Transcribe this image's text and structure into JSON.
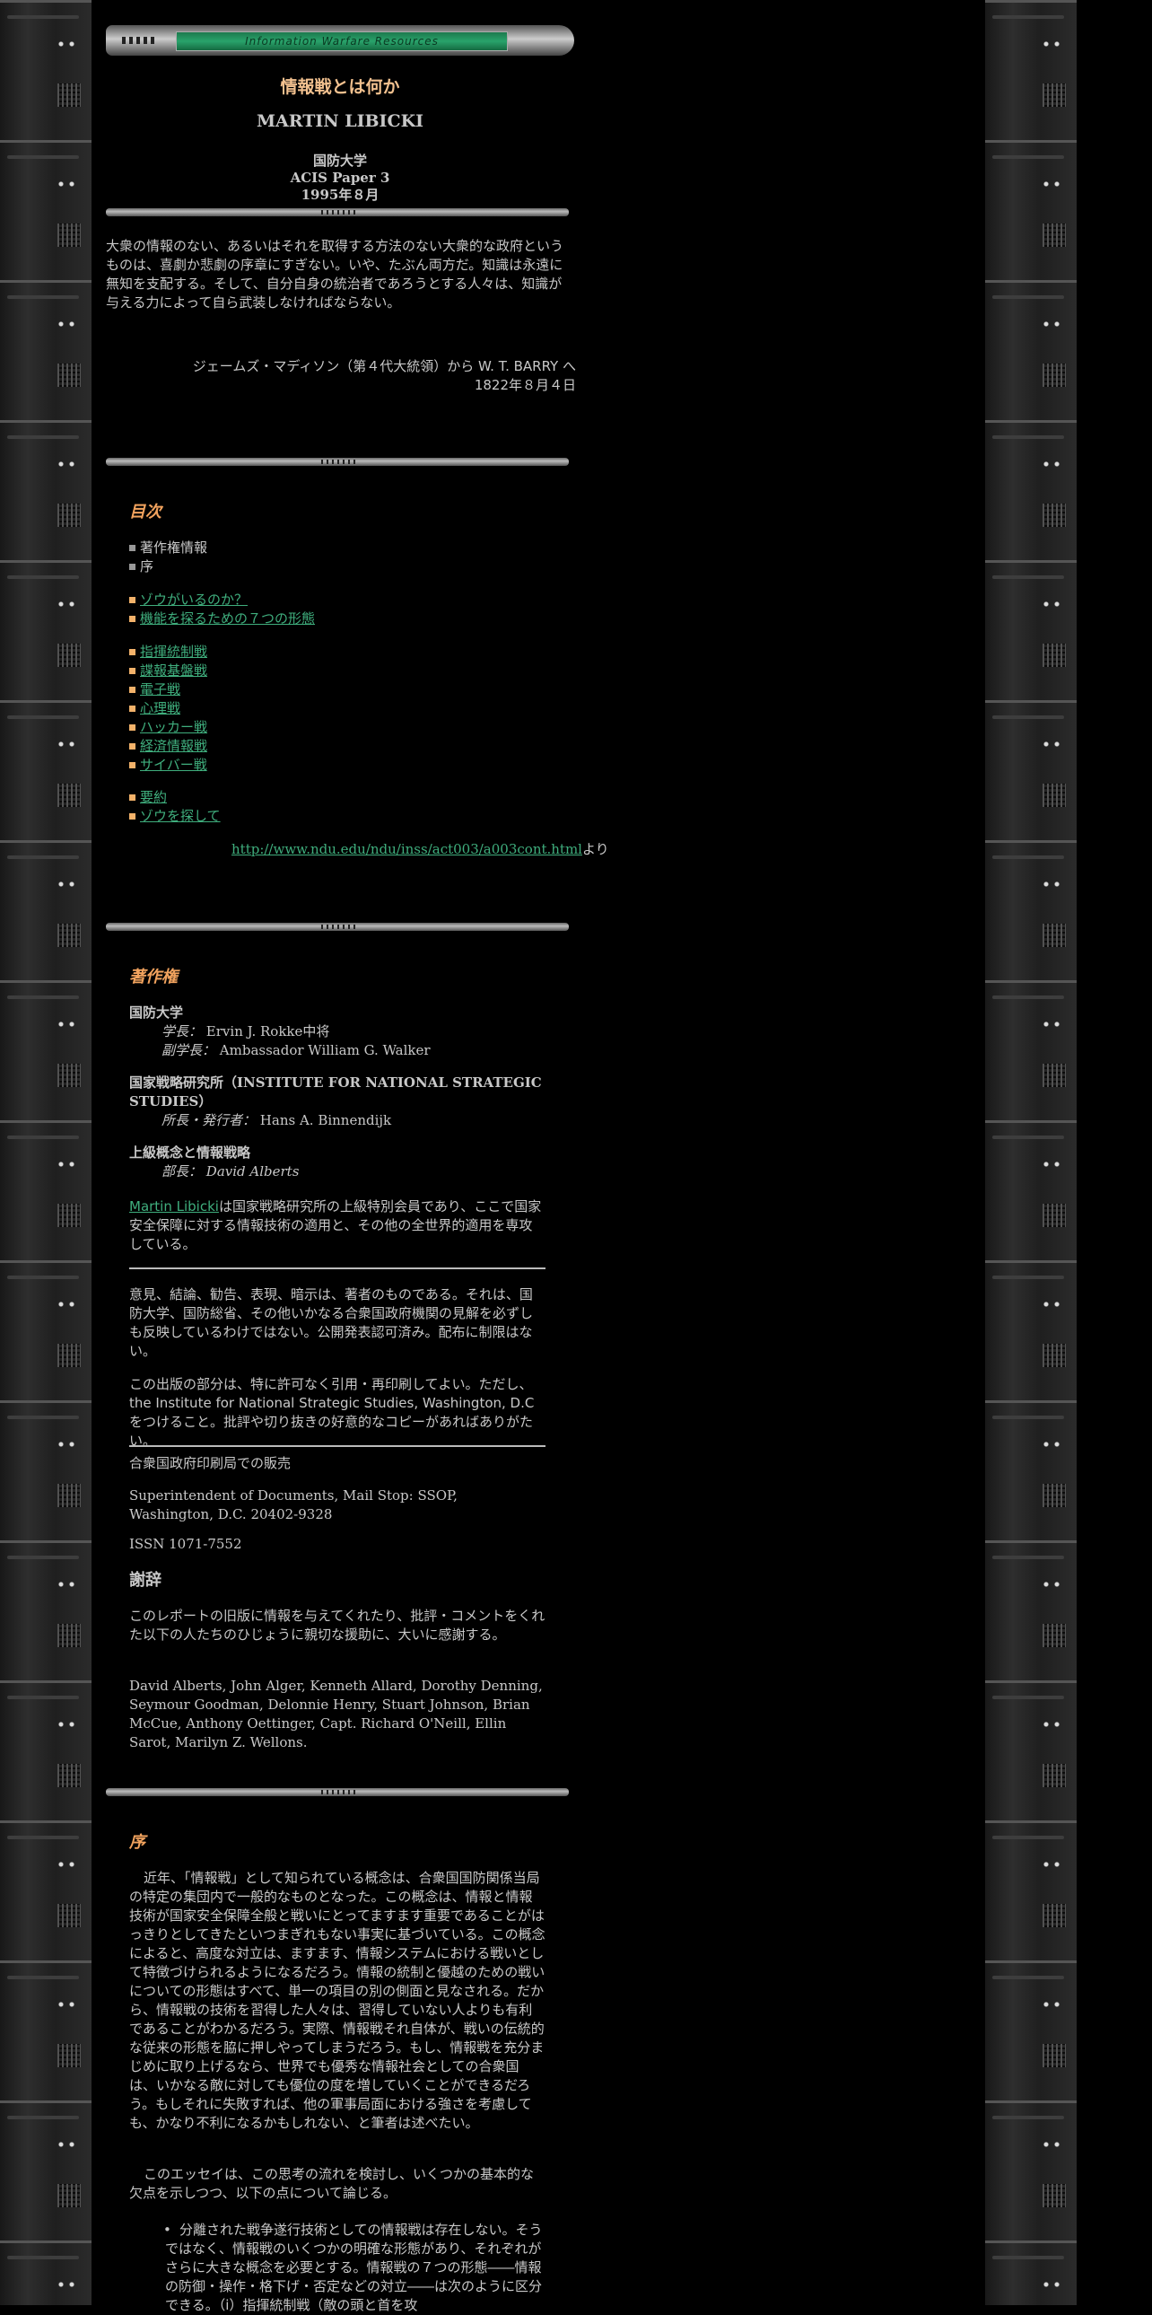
{
  "header": {
    "banner_text": "Information Warfare Resources"
  },
  "title": {
    "main": "情報戦とは何か",
    "author": "MARTIN LIBICKI",
    "org": "国防大学",
    "series": "ACIS Paper 3",
    "date": "1995年８月"
  },
  "quote": {
    "text": "大衆の情報のない、あるいはそれを取得する方法のない大衆的な政府というものは、喜劇か悲劇の序章にすぎない。いや、たぶん両方だ。知識は永遠に無知を支配する。そして、自分自身の統治者であろうとする人々は、知識が与える力によって自ら武装しなければならない。",
    "attr_line1": "ジェームズ・マディソン（第４代大統領）から W. T. BARRY へ",
    "attr_line2": "1822年８月４日"
  },
  "toc": {
    "heading": "目次",
    "group1": [
      "著作権情報",
      "序"
    ],
    "group2": [
      "ゾウがいるのか？",
      "機能を探るための７つの形態"
    ],
    "group3": [
      "指揮統制戦",
      "諜報基盤戦",
      "電子戦",
      "心理戦",
      "ハッカー戦",
      "経済情報戦",
      "サイバー戦"
    ],
    "group4": [
      "要約",
      "ゾウを探して"
    ],
    "source_url": "http://www.ndu.edu/ndu/inss/act003/a003cont.html",
    "source_suffix": "より"
  },
  "copyright": {
    "heading": "著作権",
    "org1": "国防大学",
    "org1_role1": "学長：",
    "org1_name1": "Ervin J. Rokke中将",
    "org1_role2": "副学長：",
    "org1_name2": "Ambassador William G. Walker",
    "org2": "国家戦略研究所（INSTITUTE FOR NATIONAL STRATEGIC STUDIES）",
    "org2_role": "所長・発行者：",
    "org2_name": "Hans A. Binnendijk",
    "org3": "上級概念と情報戦略",
    "org3_role": "部長：",
    "org3_name": "David Alberts",
    "author_link": "Martin Libicki",
    "author_text": "は国家戦略研究所の上級特別会員であり、ここで国家安全保障に対する情報技術の適用と、その他の全世界的適用を専攻している。",
    "disclaimer": "意見、結論、勧告、表現、暗示は、著者のものである。それは、国防大学、国防総省、その他いかなる合衆国政府機関の見解を必ずしも反映しているわけではない。公開発表認可済み。配布に制限はない。",
    "reprint": "この出版の部分は、特に許可なく引用・再印刷してよい。ただし、the Institute for National Strategic Studies, Washington, D.C をつけること。批評や切り抜きの好意的なコピーがあればありがたい。",
    "sale": "合衆国政府印刷局での販売",
    "address": "Superintendent of Documents, Mail Stop: SSOP, Washington, D.C. 20402-9328",
    "issn": "ISSN 1071-7552",
    "thanks_heading": "謝辞",
    "thanks_text": "このレポートの旧版に情報を与えてくれたり、批評・コメントをくれた以下の人たちのひじょうに親切な援助に、大いに感謝する。",
    "thanks_names": "David Alberts, John Alger, Kenneth Allard, Dorothy Denning, Seymour Goodman, Delonnie Henry, Stuart Johnson, Brian McCue, Anthony Oettinger, Capt. Richard O'Neill, Ellin Sarot, Marilyn Z. Wellons."
  },
  "preface": {
    "heading": "序",
    "para1": "近年、「情報戦」として知られている概念は、合衆国国防関係当局の特定の集団内で一般的なものとなった。この概念は、情報と情報技術が国家安全保障全般と戦いにとってますます重要であることがはっきりとしてきたといつまぎれもない事実に基づいている。この概念によると、高度な対立は、ますます、情報システムにおける戦いとして特徴づけられるようになるだろう。情報の統制と優越のための戦いについての形態はすべて、単一の項目の別の側面と見なされる。だから、情報戦の技術を習得した人々は、習得していない人よりも有利であることがわかるだろう。実際、情報戦それ自体が、戦いの伝統的な従来の形態を脇に押しやってしまうだろう。もし、情報戦を充分まじめに取り上げるなら、世界でも優秀な情報社会としての合衆国は、いかなる敵に対しても優位の度を増していくことができるだろう。もしそれに失敗すれば、他の軍事局面における強さを考慮しても、かなり不利になるかもしれない、と筆者は述べたい。",
    "para2": "このエッセイは、この思考の流れを検討し、いくつかの基本的な欠点を示しつつ、以下の点について論じる。",
    "bullet1": "分離された戦争遂行技術としての情報戦は存在しない。そうではなく、情報戦のいくつかの明確な形態があり、それぞれがさらに大きな概念を必要とする。情報戦の７つの形態――情報の防御・操作・格下げ・否定などの対立――は次のように区分できる。（i）指揮統制戦（敵の頭と首を攻"
  }
}
